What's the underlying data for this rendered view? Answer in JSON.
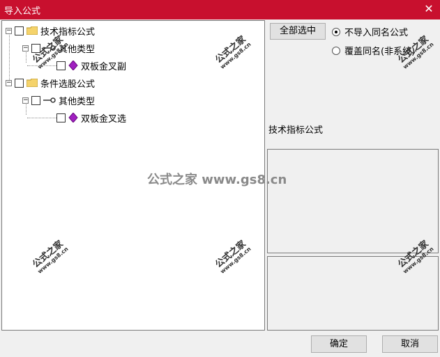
{
  "window": {
    "title": "导入公式",
    "close_glyph": "✕"
  },
  "tree": {
    "items": [
      {
        "label": "技术指标公式",
        "level": 0
      },
      {
        "label": "其他类型",
        "level": 1
      },
      {
        "label": "双板金叉副",
        "level": 2
      },
      {
        "label": "条件选股公式",
        "level": 0
      },
      {
        "label": "其他类型",
        "level": 1
      },
      {
        "label": "双板金叉选",
        "level": 2
      }
    ],
    "expanded_glyph": "−"
  },
  "options": {
    "select_all_label": "全部选中",
    "radio_skip_label": "不导入同名公式",
    "radio_overwrite_label": "覆盖同名(非系统)",
    "selected_radio": "skip"
  },
  "info": {
    "category_label": "技术指标公式"
  },
  "footer": {
    "ok_label": "确定",
    "cancel_label": "取消"
  },
  "watermark": {
    "brand": "公式之家",
    "site": "www.gs8.cn",
    "center": "公式之家 www.gs8.cn"
  },
  "colors": {
    "titlebar": "#c8102e",
    "folder": "#f5d36b",
    "gem": "#a020c0"
  }
}
